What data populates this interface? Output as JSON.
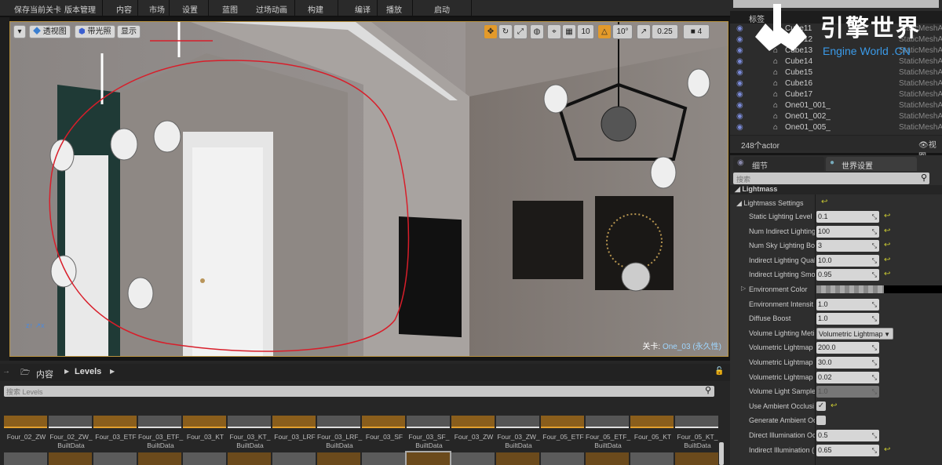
{
  "toolbar": {
    "items": [
      "保存当前关卡",
      "版本管理",
      "内容",
      "市场",
      "设置",
      "蓝图",
      "过场动画",
      "构建",
      "编译",
      "播放",
      "启动"
    ]
  },
  "viewport": {
    "buttons": {
      "menu": "▾",
      "perspective": "透视图",
      "lit": "带光照",
      "show": "显示"
    },
    "tools": {
      "grid_snap": "10",
      "rot_snap": "10°",
      "scale_snap": "0.25",
      "cam_speed": "4"
    },
    "level_label": "关卡:",
    "level_name": "One_03 (永久性)",
    "annotation_color": "#d81e2a"
  },
  "content_browser": {
    "breadcrumb": [
      "内容",
      "Levels"
    ],
    "search_placeholder": "搜索 Levels",
    "assets": [
      {
        "l1": "Four_02_ZW",
        "l2": "",
        "type": "level"
      },
      {
        "l1": "Four_02_ZW_",
        "l2": "BuiltData",
        "type": "data"
      },
      {
        "l1": "Four_03_ETF",
        "l2": "",
        "type": "level"
      },
      {
        "l1": "Four_03_ETF_",
        "l2": "BuiltData",
        "type": "data"
      },
      {
        "l1": "Four_03_KT",
        "l2": "",
        "type": "level"
      },
      {
        "l1": "Four_03_KT_",
        "l2": "BuiltData",
        "type": "data"
      },
      {
        "l1": "Four_03_LRF",
        "l2": "",
        "type": "level"
      },
      {
        "l1": "Four_03_LRF_",
        "l2": "BuiltData",
        "type": "data"
      },
      {
        "l1": "Four_03_SF",
        "l2": "",
        "type": "level"
      },
      {
        "l1": "Four_03_SF_",
        "l2": "BuiltData",
        "type": "data"
      },
      {
        "l1": "Four_03_ZW",
        "l2": "",
        "type": "level"
      },
      {
        "l1": "Four_03_ZW_",
        "l2": "BuiltData",
        "type": "data"
      },
      {
        "l1": "Four_05_ETF",
        "l2": "",
        "type": "level"
      },
      {
        "l1": "Four_05_ETF_",
        "l2": "BuiltData",
        "type": "data"
      },
      {
        "l1": "Four_05_KT",
        "l2": "",
        "type": "level"
      },
      {
        "l1": "Four_05_KT_",
        "l2": "BuiltData",
        "type": "data"
      }
    ]
  },
  "outliner": {
    "col_label": "标签",
    "rows": [
      {
        "name": "Cube11",
        "type": "StaticMeshActor"
      },
      {
        "name": "Cube12",
        "type": "StaticMeshActor"
      },
      {
        "name": "Cube13",
        "type": "StaticMeshActor"
      },
      {
        "name": "Cube14",
        "type": "StaticMeshActor"
      },
      {
        "name": "Cube15",
        "type": "StaticMeshActor"
      },
      {
        "name": "Cube16",
        "type": "StaticMeshActor"
      },
      {
        "name": "Cube17",
        "type": "StaticMeshActor"
      },
      {
        "name": "One01_001_",
        "type": "StaticMeshActor"
      },
      {
        "name": "One01_002_",
        "type": "StaticMeshActor"
      },
      {
        "name": "One01_005_",
        "type": "StaticMeshActor"
      }
    ],
    "count": "248个actor",
    "view_options": "视图"
  },
  "watermark": {
    "cn": "引擎世界",
    "en": "Engine World .CN"
  },
  "details": {
    "tabs": [
      "细节",
      "世界设置"
    ],
    "search_placeholder": "搜索",
    "section": "Lightmass",
    "group": "Lightmass Settings",
    "rows": [
      {
        "label": "Static Lighting Level",
        "value": "0.1",
        "kind": "num",
        "reset": true
      },
      {
        "label": "Num Indirect Lighting",
        "value": "100",
        "kind": "num",
        "reset": true
      },
      {
        "label": "Num Sky Lighting Bo",
        "value": "3",
        "kind": "num",
        "reset": true
      },
      {
        "label": "Indirect Lighting Qual",
        "value": "10.0",
        "kind": "num",
        "reset": true
      },
      {
        "label": "Indirect Lighting Smo",
        "value": "0.95",
        "kind": "num",
        "reset": true
      },
      {
        "label": "Environment Color",
        "value": "",
        "kind": "color",
        "reset": false
      },
      {
        "label": "Environment Intensit",
        "value": "1.0",
        "kind": "num",
        "reset": false
      },
      {
        "label": "Diffuse Boost",
        "value": "1.0",
        "kind": "num",
        "reset": false
      },
      {
        "label": "Volume Lighting Meti",
        "value": "Volumetric Lightmap",
        "kind": "combo",
        "reset": false
      },
      {
        "label": "Volumetric Lightmap",
        "value": "200.0",
        "kind": "num",
        "reset": false
      },
      {
        "label": "Volumetric Lightmap",
        "value": "30.0",
        "kind": "num",
        "reset": false
      },
      {
        "label": "Volumetric Lightmap",
        "value": "0.02",
        "kind": "num",
        "reset": false
      },
      {
        "label": "Volume Light Sample",
        "value": "1.0",
        "kind": "disabled",
        "reset": false
      },
      {
        "label": "Use Ambient Occlusi",
        "value": true,
        "kind": "check",
        "reset": true
      },
      {
        "label": "Generate Ambient Oc",
        "value": false,
        "kind": "check",
        "reset": false
      },
      {
        "label": "Direct Illumination Oc",
        "value": "0.5",
        "kind": "num",
        "reset": false
      },
      {
        "label": "Indirect Illumination (",
        "value": "0.65",
        "kind": "num",
        "reset": true
      }
    ]
  }
}
